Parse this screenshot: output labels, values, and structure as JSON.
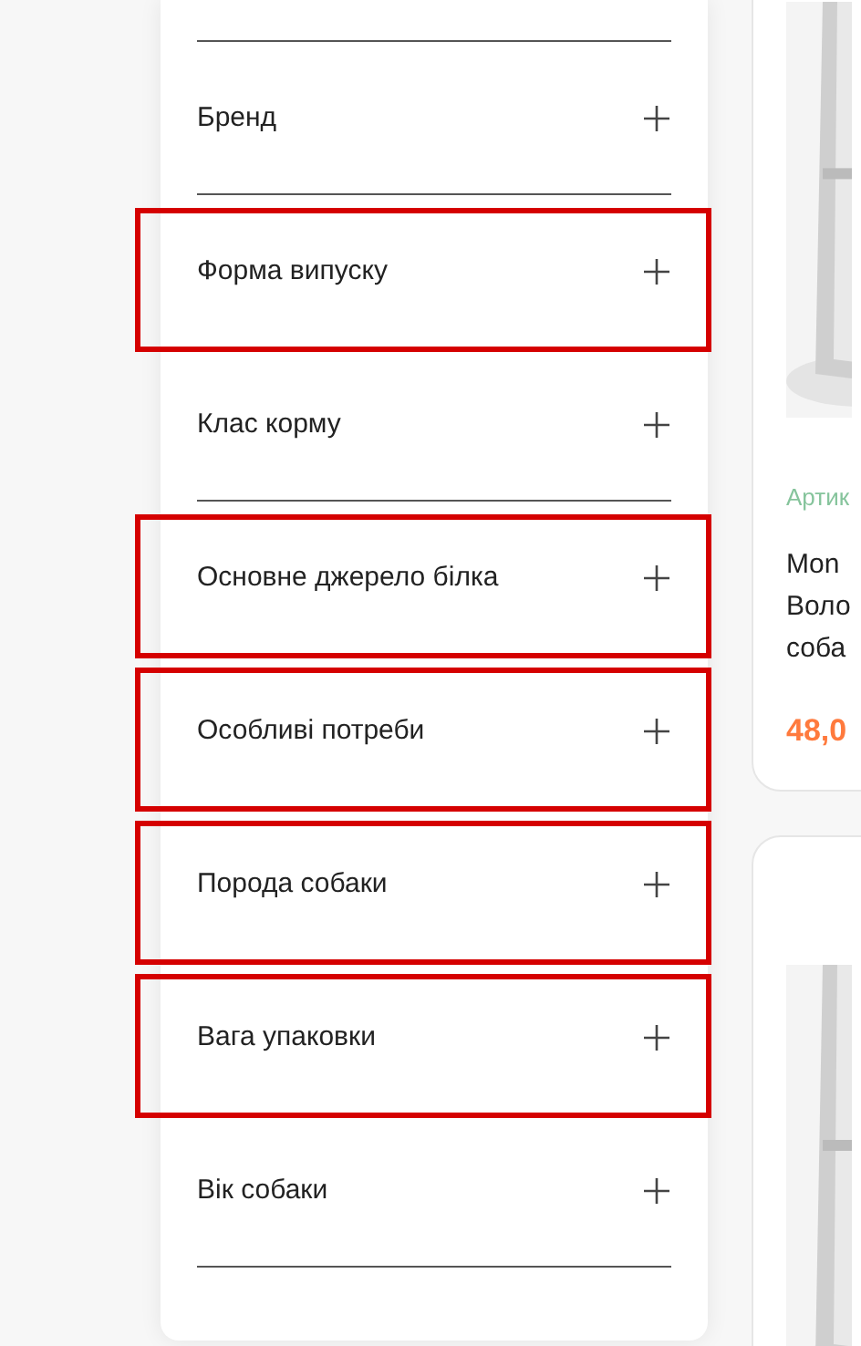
{
  "filters": [
    {
      "label": "Бренд",
      "expanded": false,
      "highlighted": false
    },
    {
      "label": "Форма випуску",
      "expanded": false,
      "highlighted": true
    },
    {
      "label": "Клас корму",
      "expanded": false,
      "highlighted": false
    },
    {
      "label": "Основне джерело білка",
      "expanded": false,
      "highlighted": true
    },
    {
      "label": "Особливі потреби",
      "expanded": false,
      "highlighted": true
    },
    {
      "label": "Порода собаки",
      "expanded": false,
      "highlighted": true
    },
    {
      "label": "Вага упаковки",
      "expanded": false,
      "highlighted": true
    },
    {
      "label": "Вік собаки",
      "expanded": false,
      "highlighted": false
    }
  ],
  "products": [
    {
      "sku": "Артик",
      "title_lines": [
        "Mon",
        "Воло",
        "соба"
      ],
      "price": "48,0"
    },
    {
      "kind": "picture"
    }
  ]
}
